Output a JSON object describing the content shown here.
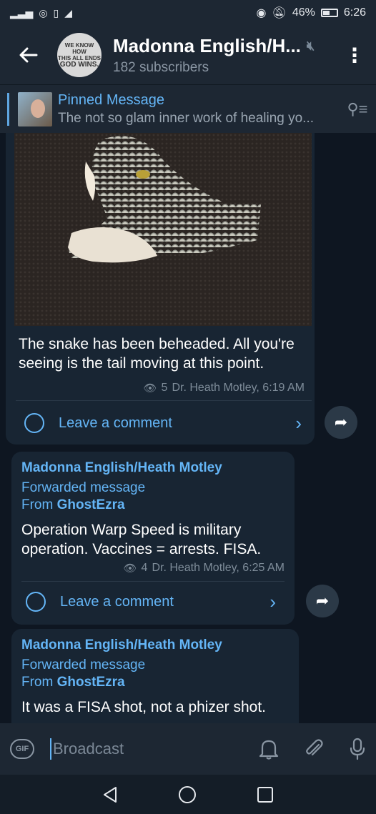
{
  "status_bar": {
    "signal": "ull",
    "battery_percent": "46%",
    "time": "6:26"
  },
  "header": {
    "back_icon": "arrow-left-icon",
    "avatar_lines": [
      "WE KNOW HOW",
      "THIS ALL ENDS",
      "GOD WINS."
    ],
    "title": "Madonna English/H...",
    "subscribers": "182 subscribers",
    "menu_icon": "kebab-menu-icon"
  },
  "pinned": {
    "label": "Pinned Message",
    "preview": "The not so glam inner work of healing yo..."
  },
  "messages": [
    {
      "text": "The snake has been beheaded. All you're seeing is the tail moving at this point.",
      "views": "5",
      "author_time": "Dr. Heath Motley, 6:19 AM",
      "comment_label": "Leave a comment"
    },
    {
      "sender": "Madonna English/Heath Motley",
      "forwarded_label": "Forwarded message",
      "from_prefix": "From",
      "from_name": "GhostEzra",
      "text": "Operation Warp Speed is military operation. Vaccines = arrests. FISA.",
      "views": "4",
      "author_time": "Dr. Heath Motley, 6:25 AM",
      "comment_label": "Leave a comment"
    },
    {
      "sender": "Madonna English/Heath Motley",
      "forwarded_label": "Forwarded message",
      "from_prefix": "From",
      "from_name": "GhostEzra",
      "text": "It was a FISA shot, not a phizer shot."
    }
  ],
  "composer": {
    "gif_label": "GIF",
    "placeholder": "Broadcast"
  },
  "colors": {
    "background": "#0e1621",
    "bar": "#1d2733",
    "bubble": "#182533",
    "accent": "#64b5f6"
  }
}
